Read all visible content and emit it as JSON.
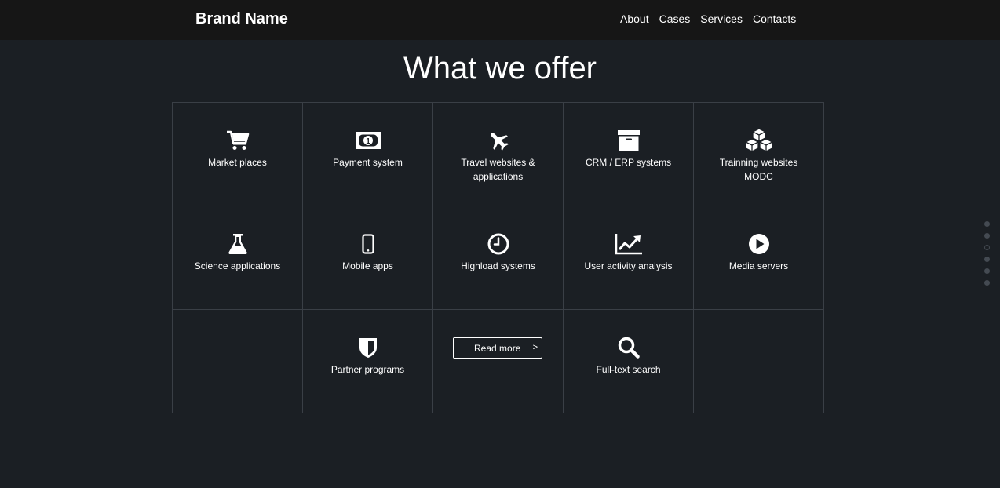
{
  "header": {
    "brand": "Brand Name",
    "nav": [
      "About",
      "Cases",
      "Services",
      "Contacts"
    ]
  },
  "section": {
    "title": "What we offer"
  },
  "services": [
    {
      "label": "Market places",
      "icon": "cart-icon"
    },
    {
      "label": "Payment system",
      "icon": "money-bill-icon"
    },
    {
      "label": "Travel websites & applications",
      "icon": "plane-icon"
    },
    {
      "label": "CRM / ERP systems",
      "icon": "archive-box-icon"
    },
    {
      "label": "Trainning websites MODC",
      "icon": "cubes-icon"
    },
    {
      "label": "Science applications",
      "icon": "flask-icon"
    },
    {
      "label": "Mobile apps",
      "icon": "mobile-icon"
    },
    {
      "label": "Highload systems",
      "icon": "clock-icon"
    },
    {
      "label": "User activity analysis",
      "icon": "line-chart-icon"
    },
    {
      "label": "Media servers",
      "icon": "play-circle-icon"
    },
    {
      "label": "Partner programs",
      "icon": "shield-icon"
    },
    {
      "label": "Full-text search",
      "icon": "search-icon"
    }
  ],
  "read_more": {
    "label": "Read more",
    "arrow": ">"
  },
  "page_dots": {
    "count": 6,
    "active_index": 2
  },
  "colors": {
    "background": "#1b1f24",
    "topbar": "#161616",
    "grid_border": "#3a3f46",
    "dot": "#444a52",
    "text": "#ffffff"
  }
}
